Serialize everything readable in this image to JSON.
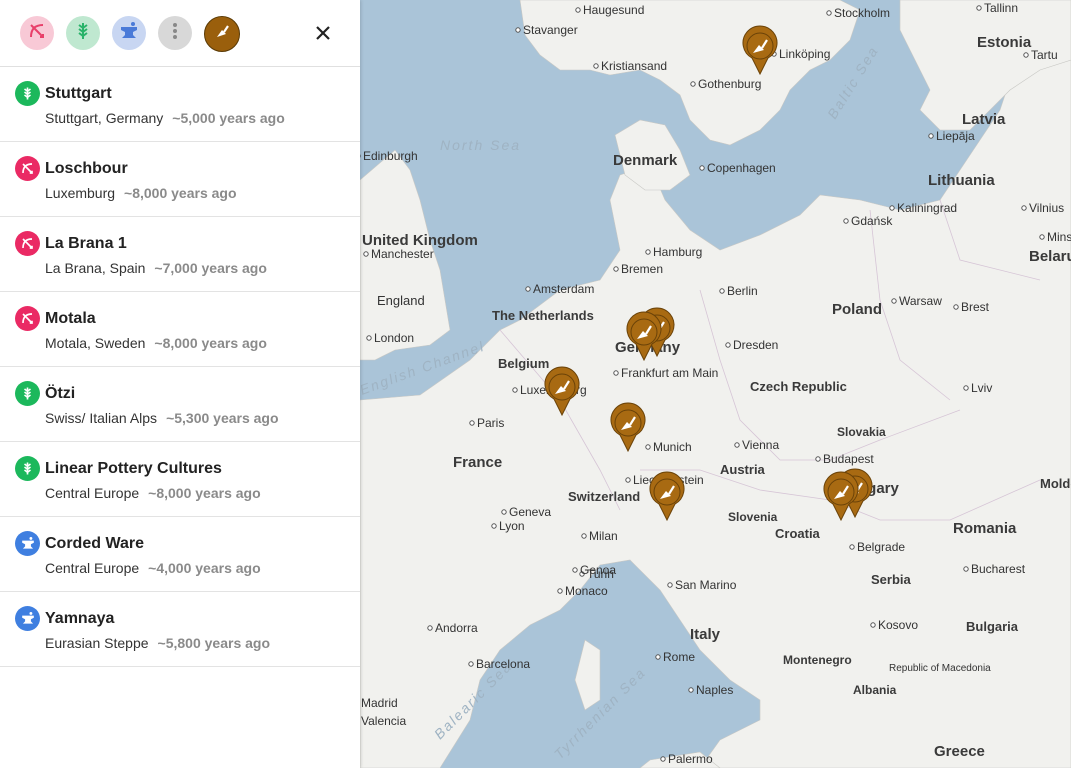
{
  "toolbar": {
    "filters": [
      {
        "name": "hunter-gatherer-filter",
        "icon": "bow-arrow-icon",
        "bg": "#f8c9d6",
        "fg": "#e8406a"
      },
      {
        "name": "farmer-filter",
        "icon": "wheat-icon",
        "bg": "#bfe8d0",
        "fg": "#29b36a"
      },
      {
        "name": "herder-filter",
        "icon": "anvil-icon",
        "bg": "#c8d6f2",
        "fg": "#4a7ad8"
      },
      {
        "name": "more-filter",
        "icon": "more-vertical-icon",
        "bg": "#d8d8d8",
        "fg": "#888888"
      },
      {
        "name": "dig-site-filter",
        "icon": "trowel-icon",
        "bg": "#9a5f0c",
        "fg": "#ffffff"
      }
    ],
    "close_icon": "close-icon"
  },
  "colors": {
    "hunter": "#ea2a64",
    "farmer": "#1cb85c",
    "herder": "#3f7fe0",
    "pin": "#a86a12",
    "water": "#aac4d8",
    "land": "#f2f2ef"
  },
  "samples": [
    {
      "name": "Stuttgart",
      "place": "Stuttgart, Germany",
      "age": "~5,000 years ago",
      "type": "farmer"
    },
    {
      "name": "Loschbour",
      "place": "Luxemburg",
      "age": "~8,000 years ago",
      "type": "hunter"
    },
    {
      "name": "La Brana 1",
      "place": "La Brana, Spain",
      "age": "~7,000 years ago",
      "type": "hunter"
    },
    {
      "name": "Motala",
      "place": "Motala, Sweden",
      "age": "~8,000 years ago",
      "type": "hunter"
    },
    {
      "name": "Ötzi",
      "place": "Swiss/ Italian Alps",
      "age": "~5,300 years ago",
      "type": "farmer"
    },
    {
      "name": "Linear Pottery Cultures",
      "place": "Central Europe",
      "age": "~8,000 years ago",
      "type": "farmer"
    },
    {
      "name": "Corded Ware",
      "place": "Central Europe",
      "age": "~4,000 years ago",
      "type": "herder"
    },
    {
      "name": "Yamnaya",
      "place": "Eurasian Steppe",
      "age": "~5,800 years ago",
      "type": "herder"
    }
  ],
  "map": {
    "cities": [
      "Haugesund",
      "Stavanger",
      "Kristiansand",
      "Stockholm",
      "Tallinn",
      "Tartu",
      "Linköping",
      "Gothenburg",
      "Liepāja",
      "Edinburgh",
      "Copenhagen",
      "Kaliningrad",
      "Vilnius",
      "Gdańsk",
      "Minsk",
      "Manchester",
      "Hamburg",
      "Bremen",
      "Berlin",
      "Amsterdam",
      "Warsaw",
      "Brest",
      "London",
      "Dresden",
      "Frankfurt am Main",
      "Luxembourg",
      "Paris",
      "Lviv",
      "Munich",
      "Vienna",
      "Liechtenstein",
      "Budapest",
      "Geneva",
      "Lyon",
      "Milan",
      "Turin",
      "Genoa",
      "Monaco",
      "San Marino",
      "Belgrade",
      "Bucharest",
      "Kosovo",
      "Andorra",
      "Barcelona",
      "Rome",
      "Naples",
      "Valencia",
      "Madrid",
      "Palermo"
    ],
    "countries": [
      "Estonia",
      "Latvia",
      "Lithuania",
      "Denmark",
      "Belarus",
      "United Kingdom",
      "England",
      "Poland",
      "The Netherlands",
      "Belgium",
      "Germany",
      "Czech Republic",
      "Slovakia",
      "France",
      "Austria",
      "Hungary",
      "Moldova",
      "Switzerland",
      "Slovenia",
      "Croatia",
      "Romania",
      "Serbia",
      "Italy",
      "Montenegro",
      "Bulgaria",
      "Albania",
      "Republic of Macedonia",
      "Greece"
    ],
    "seas": [
      "North Sea",
      "Baltic Sea",
      "English Channel",
      "Balearic Sea",
      "Tyrrhenian Sea"
    ]
  }
}
